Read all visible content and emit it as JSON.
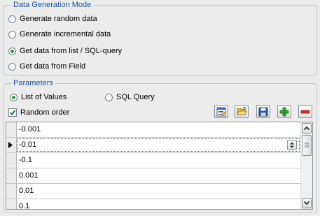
{
  "generation_mode": {
    "title": "Data Generation Mode",
    "options": [
      {
        "label": "Generate random data",
        "checked": false
      },
      {
        "label": "Generate incremental data",
        "checked": false
      },
      {
        "label": "Get data from list / SQL-query",
        "checked": true
      },
      {
        "label": "Get data from Field",
        "checked": false
      }
    ]
  },
  "parameters": {
    "title": "Parameters",
    "list_of_values_label": "List of Values",
    "sql_query_label": "SQL Query",
    "source_selected": "List of Values",
    "random_order_label": "Random order",
    "random_order_checked": true,
    "toolbar": [
      {
        "icon": "edit-icon"
      },
      {
        "icon": "open-folder-icon"
      },
      {
        "icon": "save-icon"
      },
      {
        "icon": "add-icon"
      },
      {
        "icon": "remove-icon"
      }
    ],
    "values": [
      "-0.001",
      "-0.01",
      "-0.1",
      "0.001",
      "0.01",
      "0.1"
    ],
    "selected_index": 1
  },
  "colors": {
    "group_title": "#1a52a6",
    "radio_dot": "#2f9a2f",
    "add_green": "#2fa02f",
    "remove_red": "#d32a2a"
  }
}
